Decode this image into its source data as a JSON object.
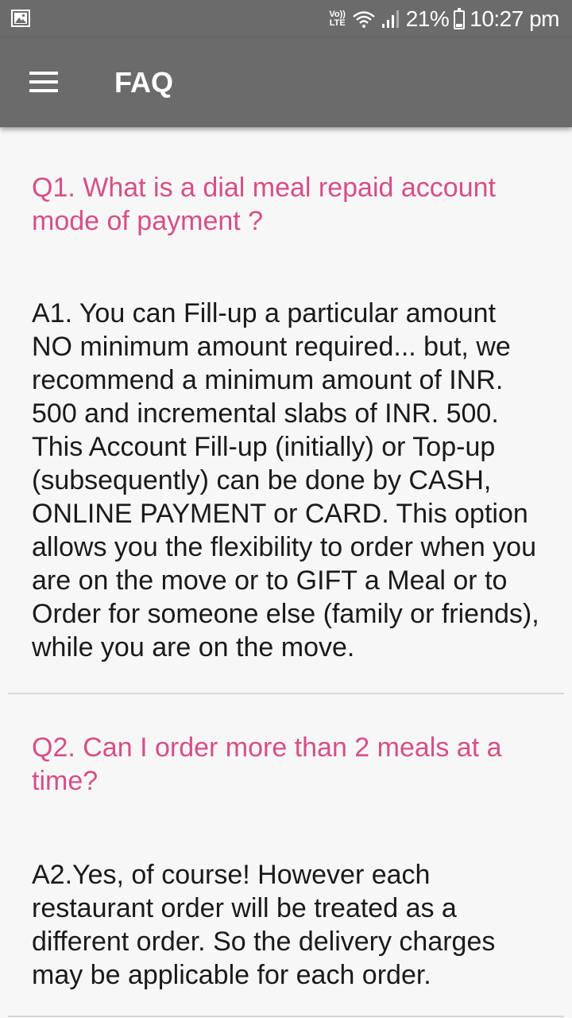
{
  "status_bar": {
    "volte_top": "Vo))",
    "volte_bottom": "LTE",
    "battery_percent": "21%",
    "battery_level": 0.21,
    "time": "10:27 pm"
  },
  "app_bar": {
    "title": "FAQ",
    "background_color": "#6b6b6b"
  },
  "faq": {
    "accent_color": "#d64f87",
    "items": [
      {
        "question": "Q1. What is a dial meal repaid account mode of payment ?",
        "answer": "A1. You can Fill-up a particular amount NO minimum amount required... but, we recommend a minimum amount of INR. 500 and incremental slabs of INR. 500. This Account Fill-up (initially) or Top-up (subsequently) can be done by CASH, ONLINE PAYMENT or CARD. This option allows you the flexibility to order when you are on the move or to GIFT a Meal or to Order for someone else (family or friends), while you are on the move."
      },
      {
        "question": "Q2. Can I order more than 2 meals at a time?",
        "answer": "A2.Yes, of course! However each restaurant order will be treated as a different order. So the delivery charges may be applicable for each order."
      }
    ]
  }
}
